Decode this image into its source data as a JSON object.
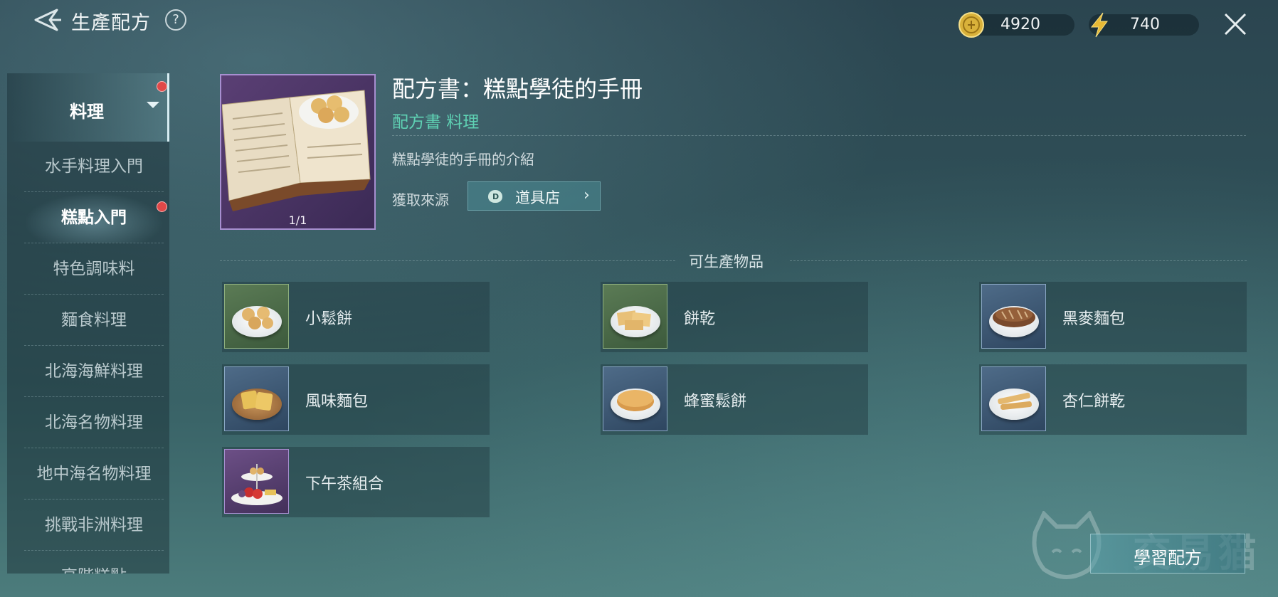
{
  "header": {
    "title": "生產配方",
    "help": "?",
    "coins": "4920",
    "energy": "740"
  },
  "sidebar": {
    "category": "料理",
    "items": [
      {
        "label": "水手料理入門"
      },
      {
        "label": "糕點入門",
        "active": true
      },
      {
        "label": "特色調味料"
      },
      {
        "label": "麵食料理"
      },
      {
        "label": "北海海鮮料理"
      },
      {
        "label": "北海名物料理"
      },
      {
        "label": "地中海名物料理"
      },
      {
        "label": "挑戰非洲料理"
      },
      {
        "label": "高階糕點"
      }
    ]
  },
  "recipe": {
    "page_count": "1/1",
    "name": "配方書：糕點學徒的手冊",
    "tags": "配方書 料理",
    "description": "糕點學徒的手冊的介紹",
    "source_label": "獲取來源",
    "source_button": "道具店",
    "source_icon": "money-bag-icon"
  },
  "products": {
    "title": "可生產物品",
    "items": [
      {
        "name": "小鬆餅",
        "frame": "green"
      },
      {
        "name": "餅乾",
        "frame": "green"
      },
      {
        "name": "黑麥麵包",
        "frame": "blue"
      },
      {
        "name": "風味麵包",
        "frame": "blue"
      },
      {
        "name": "蜂蜜鬆餅",
        "frame": "blue"
      },
      {
        "name": "杏仁餅乾",
        "frame": "blue"
      },
      {
        "name": "下午茶組合",
        "frame": "purple"
      }
    ]
  },
  "learn_button": "學習配方",
  "watermark": "交易猫",
  "colors": {
    "accent_green": "#5fd2b4",
    "badge_red": "#e04848",
    "rare_purple": "#a78fd0"
  }
}
